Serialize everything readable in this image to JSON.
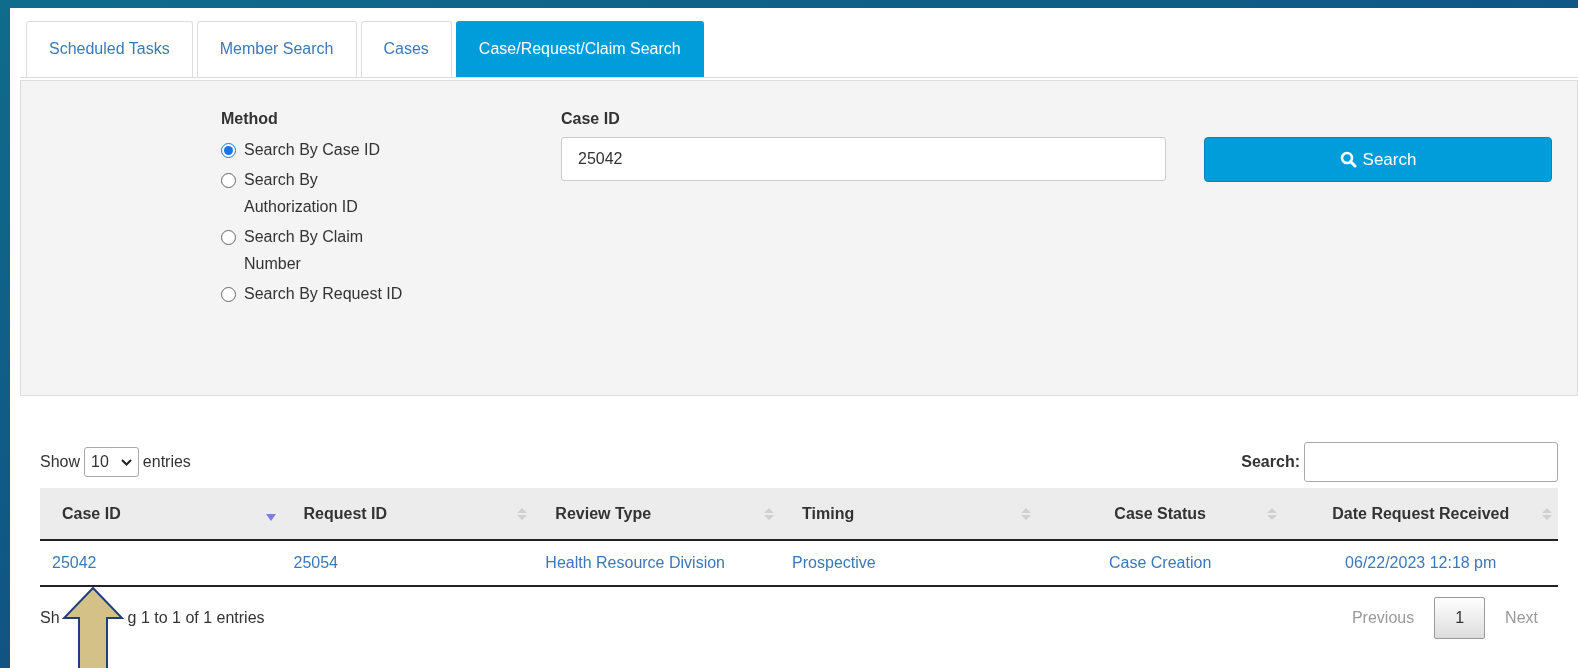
{
  "tabs": [
    {
      "label": "Scheduled Tasks",
      "selected": false
    },
    {
      "label": "Member Search",
      "selected": false
    },
    {
      "label": "Cases",
      "selected": false
    },
    {
      "label": "Case/Request/Claim Search",
      "selected": true
    }
  ],
  "search_form": {
    "method_label": "Method",
    "methods": [
      {
        "label": "Search By Case ID",
        "selected": true
      },
      {
        "label": "Search By Authorization ID",
        "selected": false
      },
      {
        "label": "Search By Claim Number",
        "selected": false
      },
      {
        "label": "Search By Request ID",
        "selected": false
      }
    ],
    "field_label": "Case ID",
    "field_value": "25042",
    "search_button": "Search"
  },
  "table_controls": {
    "show_label": "Show",
    "page_size": "10",
    "entries_label": "entries",
    "search_label": "Search:"
  },
  "table": {
    "columns": [
      {
        "label": "Case ID",
        "sorted": true
      },
      {
        "label": "Request ID",
        "sorted": false
      },
      {
        "label": "Review Type",
        "sorted": false
      },
      {
        "label": "Timing",
        "sorted": false
      },
      {
        "label": "Case Status",
        "sorted": false
      },
      {
        "label": "Date Request Received",
        "sorted": false
      }
    ],
    "rows": [
      [
        "25042",
        "25054",
        "Health Resource Division",
        "Prospective",
        "Case Creation",
        "06/22/2023 12:18 pm"
      ]
    ]
  },
  "footer": {
    "info_parts": [
      "Sh",
      "g 1 to 1 of 1 entries"
    ],
    "previous": "Previous",
    "page": "1",
    "next": "Next"
  }
}
